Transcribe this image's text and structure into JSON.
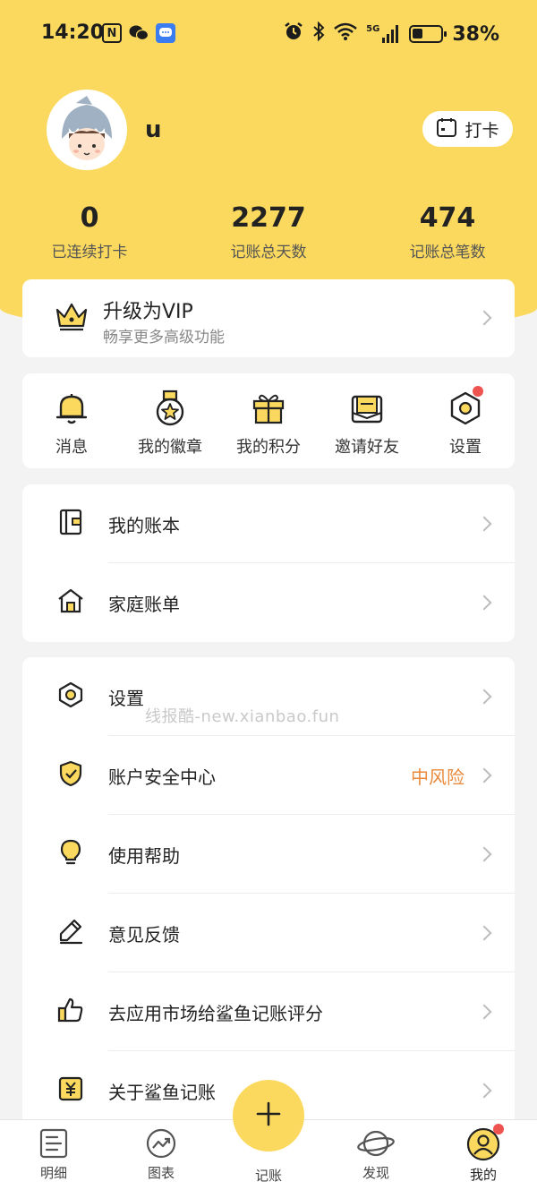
{
  "status_bar": {
    "time": "14:20",
    "left_icons": [
      "nfc-icon",
      "wechat-icon",
      "message-icon"
    ],
    "right_icons": [
      "alarm-icon",
      "bluetooth-icon",
      "wifi-icon",
      "signal-5g-icon",
      "battery-icon"
    ],
    "network": "5G",
    "battery": "38%"
  },
  "profile": {
    "username": "u",
    "checkin_label": "打卡"
  },
  "stats": [
    {
      "value": "0",
      "label": "已连续打卡"
    },
    {
      "value": "2277",
      "label": "记账总天数"
    },
    {
      "value": "474",
      "label": "记账总笔数"
    }
  ],
  "vip": {
    "title": "升级为VIP",
    "subtitle": "畅享更多高级功能"
  },
  "quick_actions": [
    {
      "label": "消息",
      "icon": "bell-icon"
    },
    {
      "label": "我的徽章",
      "icon": "medal-icon"
    },
    {
      "label": "我的积分",
      "icon": "gift-icon"
    },
    {
      "label": "邀请好友",
      "icon": "envelope-icon"
    },
    {
      "label": "设置",
      "icon": "hexagon-settings-icon",
      "badge": true
    }
  ],
  "menu_group1": [
    {
      "label": "我的账本",
      "icon": "wallet-icon"
    },
    {
      "label": "家庭账单",
      "icon": "home-icon"
    }
  ],
  "menu_group2": [
    {
      "label": "设置",
      "icon": "settings-icon"
    },
    {
      "label": "账户安全中心",
      "icon": "shield-check-icon",
      "value": "中风险"
    },
    {
      "label": "使用帮助",
      "icon": "lightbulb-icon"
    },
    {
      "label": "意见反馈",
      "icon": "edit-icon"
    },
    {
      "label": "去应用市场给鲨鱼记账评分",
      "icon": "thumbs-up-icon"
    },
    {
      "label": "关于鲨鱼记账",
      "icon": "yen-icon"
    }
  ],
  "watermark": "线报酷-new.xianbao.fun",
  "bottom_nav": [
    {
      "label": "明细",
      "icon": "list-icon"
    },
    {
      "label": "图表",
      "icon": "chart-icon"
    },
    {
      "label": "记账",
      "icon": "plus-icon"
    },
    {
      "label": "发现",
      "icon": "planet-icon"
    },
    {
      "label": "我的",
      "icon": "profile-icon",
      "badge": true
    }
  ],
  "colors": {
    "accent": "#fbd95e",
    "risk": "#e98a3c",
    "badge": "#ef5350"
  }
}
